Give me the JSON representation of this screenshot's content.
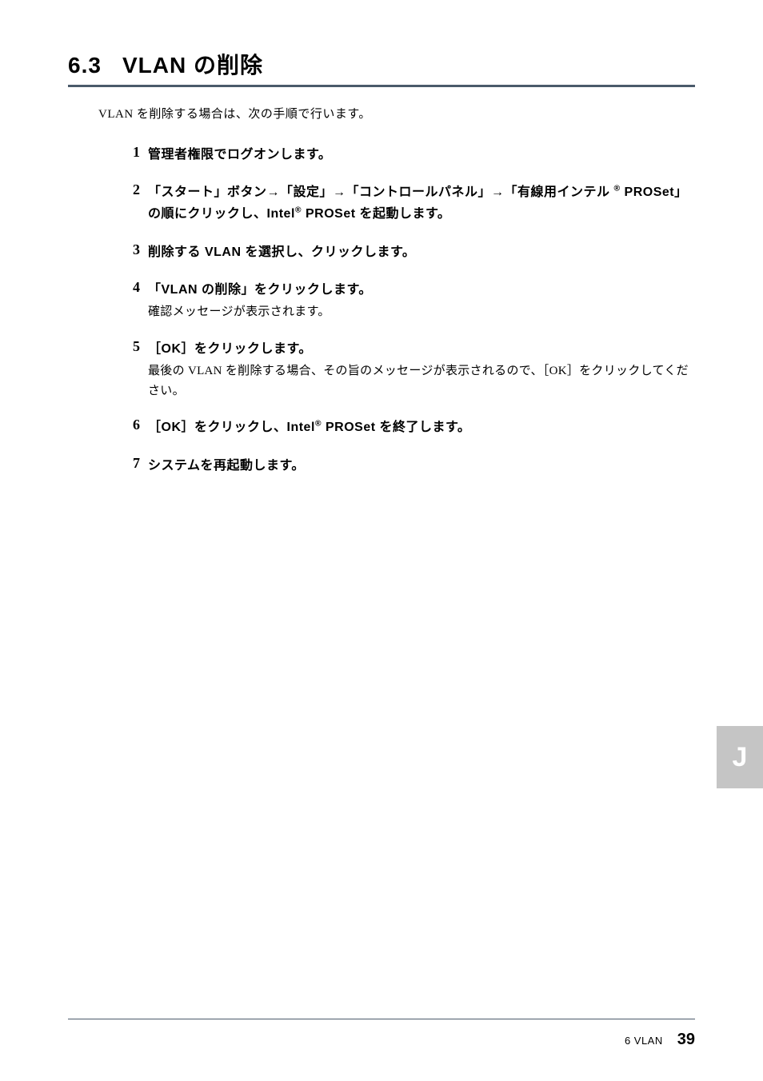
{
  "heading": {
    "number": "6.3",
    "title": "VLAN の削除"
  },
  "intro": "VLAN を削除する場合は、次の手順で行います。",
  "steps": [
    {
      "num": "1",
      "title": "管理者権限でログオンします。",
      "desc": ""
    },
    {
      "num": "2",
      "title": "「スタート」ボタン→「設定」→「コントロールパネル」→「有線用インテル ® PROSet」の順にクリックし、Intel® PROSet を起動します。",
      "desc": ""
    },
    {
      "num": "3",
      "title": "削除する VLAN を選択し、クリックします。",
      "desc": ""
    },
    {
      "num": "4",
      "title": "「VLAN の削除」をクリックします。",
      "desc": "確認メッセージが表示されます。"
    },
    {
      "num": "5",
      "title": "［OK］をクリックします。",
      "desc": "最後の VLAN を削除する場合、その旨のメッセージが表示されるので、［OK］をクリックしてください。"
    },
    {
      "num": "6",
      "title": "［OK］をクリックし、Intel® PROSet を終了します。",
      "desc": ""
    },
    {
      "num": "7",
      "title": "システムを再起動します。",
      "desc": ""
    }
  ],
  "sideTab": "J",
  "footer": {
    "chapter": "6  VLAN",
    "page": "39"
  }
}
